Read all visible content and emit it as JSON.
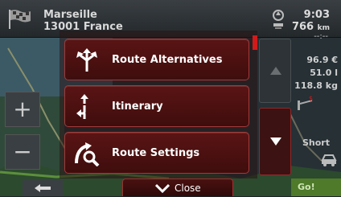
{
  "destination": {
    "line1": "Marseille",
    "line2": "13001 France"
  },
  "trip": {
    "arrival_time": "9:03",
    "distance_value": "766",
    "distance_unit": "km",
    "eta_placeholder": "--:--"
  },
  "route_stats": {
    "cost": "96.9 €",
    "volume": "51.0 l",
    "emission": "118.8 kg"
  },
  "route_type": "Short",
  "go_label": "Go!",
  "menu": {
    "items": [
      {
        "label": "Route Alternatives",
        "icon": "route-alternatives-icon"
      },
      {
        "label": "Itinerary",
        "icon": "itinerary-icon"
      },
      {
        "label": "Route Settings",
        "icon": "route-settings-icon"
      }
    ],
    "close_label": "Close"
  },
  "colors": {
    "accent": "#d21a1a",
    "menu_bg": "#4a1010",
    "go": "#4e7a2a"
  }
}
